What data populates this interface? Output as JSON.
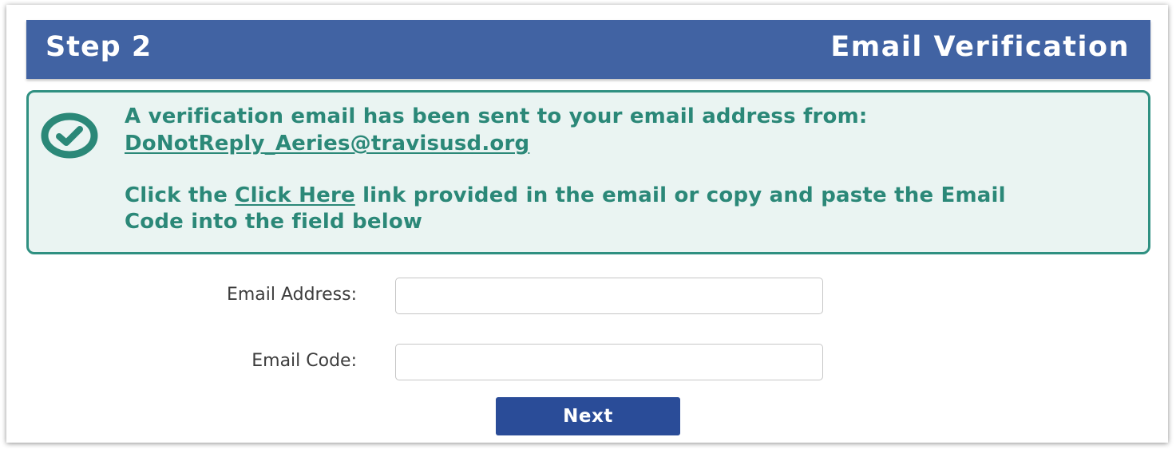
{
  "header": {
    "step": "Step 2",
    "title": "Email Verification"
  },
  "alert": {
    "icon": "check-circle-icon",
    "line1": "A verification email has been sent to your email address from:",
    "sender_email": "DoNotReply_Aeries@travisusd.org",
    "line3_prefix": "Click the ",
    "click_here_link": "Click Here",
    "line3_suffix": " link provided in the email or copy and paste the Email",
    "line4": "Code into the field below"
  },
  "form": {
    "email_label": "Email Address:",
    "email_value": "",
    "code_label": "Email Code:",
    "code_value": "",
    "next_label": "Next"
  },
  "colors": {
    "header_bg": "#4163a3",
    "alert_text": "#2b8878",
    "alert_bg": "#eaf4f2",
    "button_bg": "#2a4c98"
  }
}
